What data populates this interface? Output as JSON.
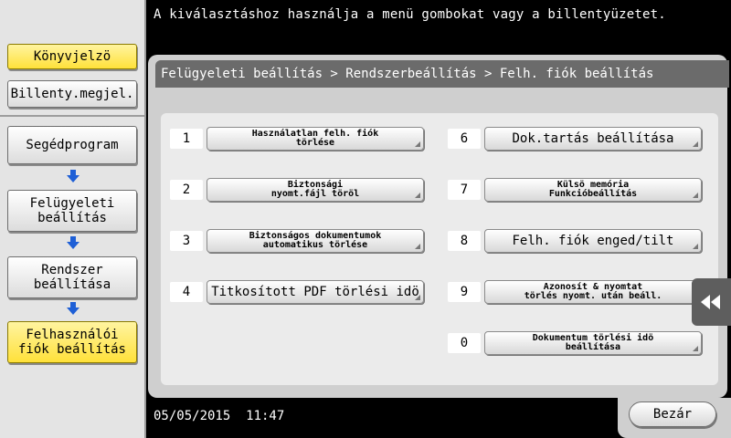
{
  "header": {
    "message": "A kiválasztáshoz használja a menü gombokat vagy a billentyüzetet."
  },
  "sidebar": {
    "bookmark": "Könyvjelzö",
    "keypad": "Billenty.megjel.",
    "path": [
      "Segédprogram",
      "Felügyeleti\nbeállítás",
      "Rendszer\nbeállítása",
      "Felhasználói\nfiók beállítás"
    ]
  },
  "breadcrumb": "Felügyeleti beállítás > Rendszerbeállítás > Felh. fiók beállítás",
  "options": [
    {
      "num": "1",
      "label": "Használatlan felh. fiók\ntörlése"
    },
    {
      "num": "2",
      "label": "Biztonsági\nnyomt.fájl töröl"
    },
    {
      "num": "3",
      "label": "Biztonságos dokumentumok\nautomatikus törlése"
    },
    {
      "num": "4",
      "label": "Titkosított PDF törlési idö"
    },
    {
      "num": "6",
      "label": "Dok.tartás beállítása"
    },
    {
      "num": "7",
      "label": "Külsö memória\nFunkcióbeállítás"
    },
    {
      "num": "8",
      "label": "Felh. fiók enged/tilt"
    },
    {
      "num": "9",
      "label": "Azonosít & nyomtat\ntörlés nyomt. után beáll."
    },
    {
      "num": "0",
      "label": "Dokumentum törlési idö\nbeállítása"
    }
  ],
  "footer": {
    "datetime": "05/05/2015  11:47",
    "close": "Bezár"
  },
  "colors": {
    "highlight": "#ffe13a",
    "panel": "#cfcfcf",
    "crumb": "#6b6b6b"
  }
}
